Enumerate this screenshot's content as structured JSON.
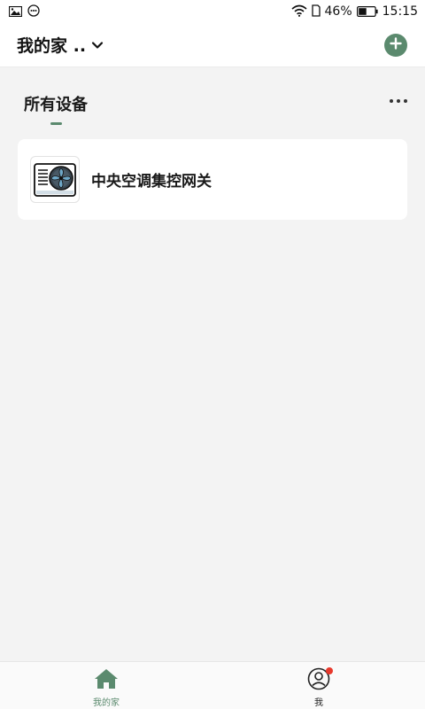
{
  "status_bar": {
    "battery_percent": "46%",
    "time": "15:15",
    "icons": [
      "image-icon",
      "message-icon",
      "wifi-icon",
      "sim-icon",
      "battery-icon"
    ]
  },
  "header": {
    "title": "我的家 ..",
    "add_icon": "plus-circle-icon"
  },
  "section": {
    "tab_label": "所有设备",
    "more_icon": "more-dots-icon"
  },
  "devices": [
    {
      "name": "中央空调集控网关",
      "icon": "ac-unit-fan-icon"
    }
  ],
  "bottom_nav": {
    "items": [
      {
        "label": "我的家",
        "icon": "home-icon",
        "active": true
      },
      {
        "label": "我",
        "icon": "user-profile-icon",
        "active": false,
        "badge": true
      }
    ]
  },
  "colors": {
    "accent": "#5b8a6e",
    "background": "#f3f3f3",
    "badge": "#e8392c"
  }
}
